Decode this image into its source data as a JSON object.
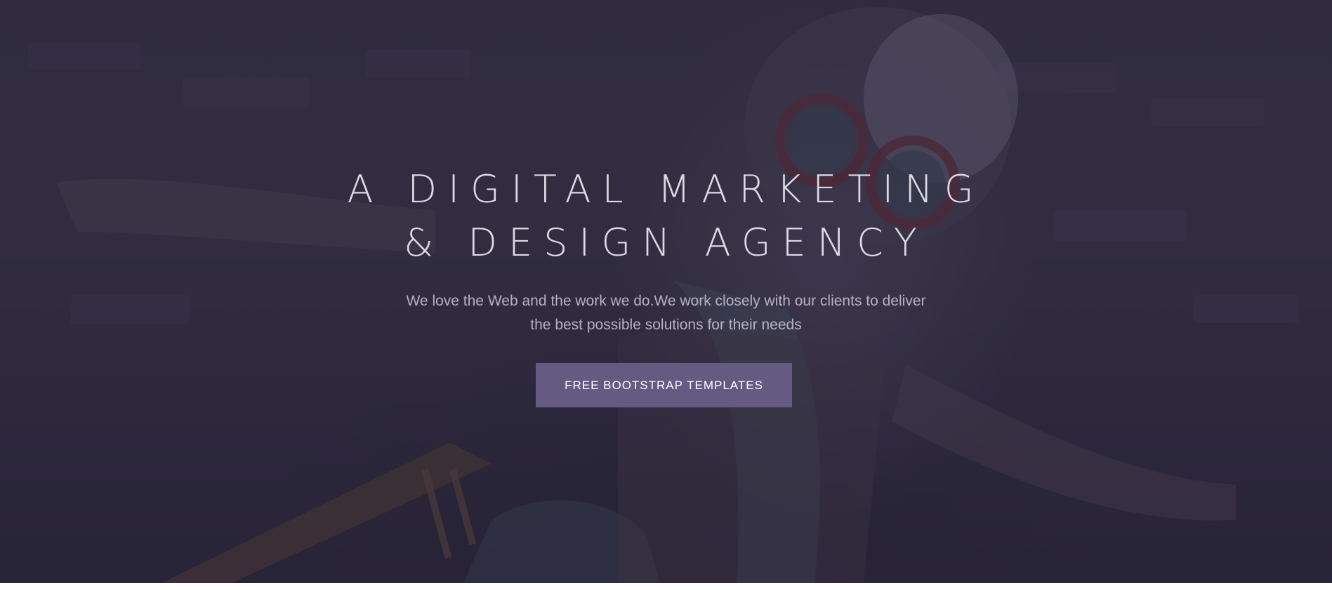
{
  "hero": {
    "headline_line1": "A DIGITAL MARKETING",
    "headline_line2": "& DESIGN AGENCY",
    "subtext_line1": "We love the Web and the work we do.We work closely with our clients to deliver",
    "subtext_line2": "the best possible solutions for their needs",
    "cta_label": "FREE BOOTSTRAP TEMPLATES"
  },
  "colors": {
    "overlay": "#262238",
    "cta_background": "#655a82",
    "headline_text": "#ebe8f2"
  }
}
